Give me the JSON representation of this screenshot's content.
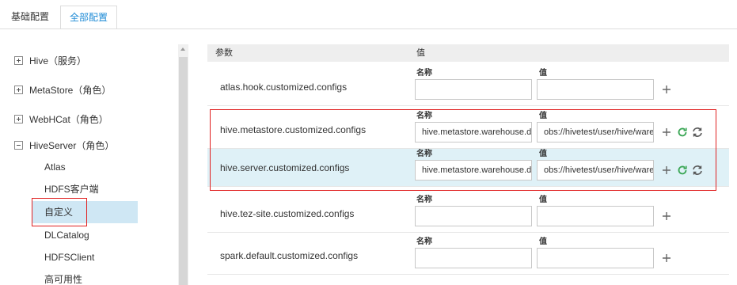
{
  "tabs": {
    "basic": "基础配置",
    "all": "全部配置"
  },
  "tree": {
    "nodes": [
      {
        "label": "Hive（服务）",
        "expanded": false
      },
      {
        "label": "MetaStore（角色）",
        "expanded": false
      },
      {
        "label": "WebHCat（角色）",
        "expanded": false
      },
      {
        "label": "HiveServer（角色）",
        "expanded": true
      }
    ],
    "children": [
      "Atlas",
      "HDFS客户端",
      "自定义",
      "DLCatalog",
      "HDFSClient",
      "高可用性"
    ],
    "selected_child": "自定义"
  },
  "table": {
    "header": {
      "param": "参数",
      "value": "值"
    },
    "name_label": "名称",
    "value_label": "值",
    "rows": [
      {
        "param": "atlas.hook.customized.configs",
        "name": "",
        "value": ""
      },
      {
        "param": "hive.metastore.customized.configs",
        "name": "hive.metastore.warehouse.dir",
        "value": "obs://hivetest/user/hive/warehouse"
      },
      {
        "param": "hive.server.customized.configs",
        "name": "hive.metastore.warehouse.dir",
        "value": "obs://hivetest/user/hive/warehouse"
      },
      {
        "param": "hive.tez-site.customized.configs",
        "name": "",
        "value": ""
      },
      {
        "param": "spark.default.customized.configs",
        "name": "",
        "value": ""
      }
    ]
  },
  "colors": {
    "accent": "#1f8bd6",
    "highlight": "#e02020",
    "selected_bg": "#cfe7f4",
    "alt_row_bg": "#dff1f7",
    "refresh_green": "#3aa655"
  },
  "icons": {
    "add": "plus-icon",
    "refresh": "refresh-icon",
    "reset": "reset-icon",
    "expand": "expand-box-icon",
    "collapse": "collapse-box-icon"
  }
}
